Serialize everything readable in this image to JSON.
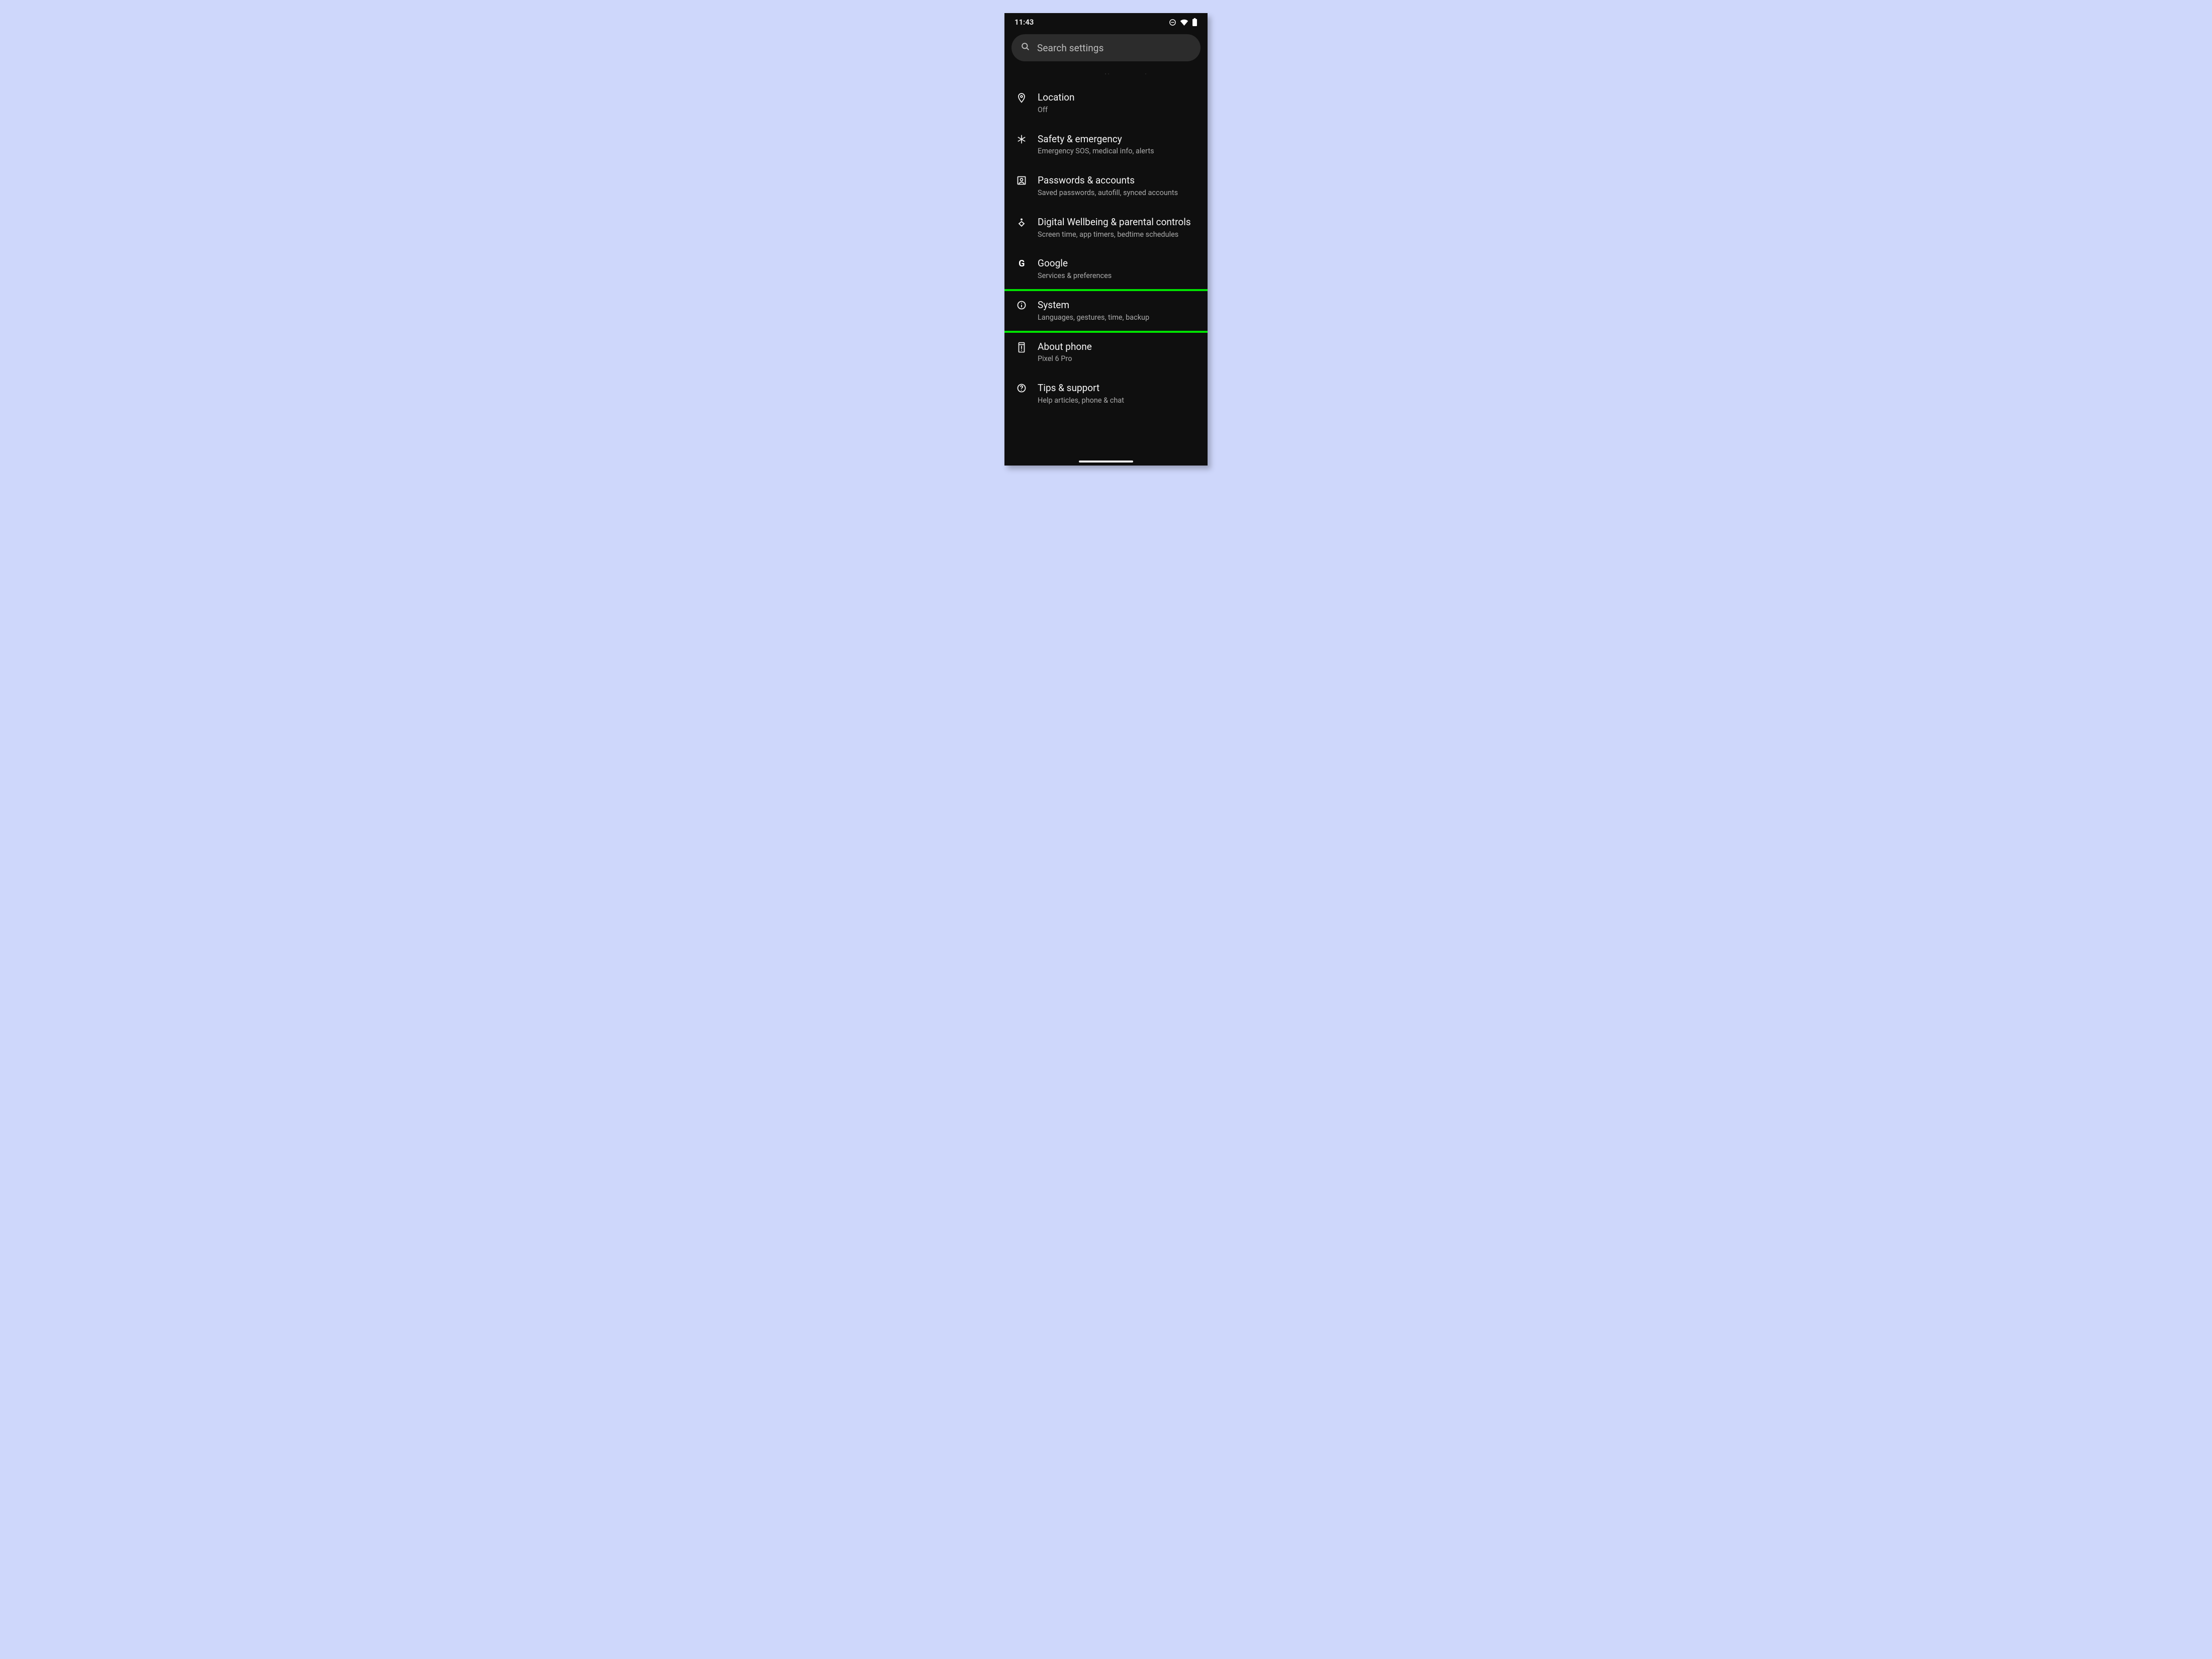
{
  "status": {
    "clock": "11:43",
    "icons": [
      "dnd",
      "wifi",
      "battery"
    ]
  },
  "search": {
    "placeholder": "Search settings"
  },
  "settings": {
    "items": [
      {
        "key": "location",
        "title": "Location",
        "subtitle": "Off",
        "highlight": false
      },
      {
        "key": "safety",
        "title": "Safety & emergency",
        "subtitle": "Emergency SOS, medical info, alerts",
        "highlight": false
      },
      {
        "key": "passwords",
        "title": "Passwords & accounts",
        "subtitle": "Saved passwords, autofill, synced accounts",
        "highlight": false
      },
      {
        "key": "wellbeing",
        "title": "Digital Wellbeing & parental controls",
        "subtitle": "Screen time, app timers, bedtime schedules",
        "highlight": false
      },
      {
        "key": "google",
        "title": "Google",
        "subtitle": "Services & preferences",
        "highlight": false
      },
      {
        "key": "system",
        "title": "System",
        "subtitle": "Languages, gestures, time, backup",
        "highlight": true
      },
      {
        "key": "about",
        "title": "About phone",
        "subtitle": "Pixel 6 Pro",
        "highlight": false
      },
      {
        "key": "tips",
        "title": "Tips & support",
        "subtitle": "Help articles, phone & chat",
        "highlight": false
      }
    ]
  }
}
